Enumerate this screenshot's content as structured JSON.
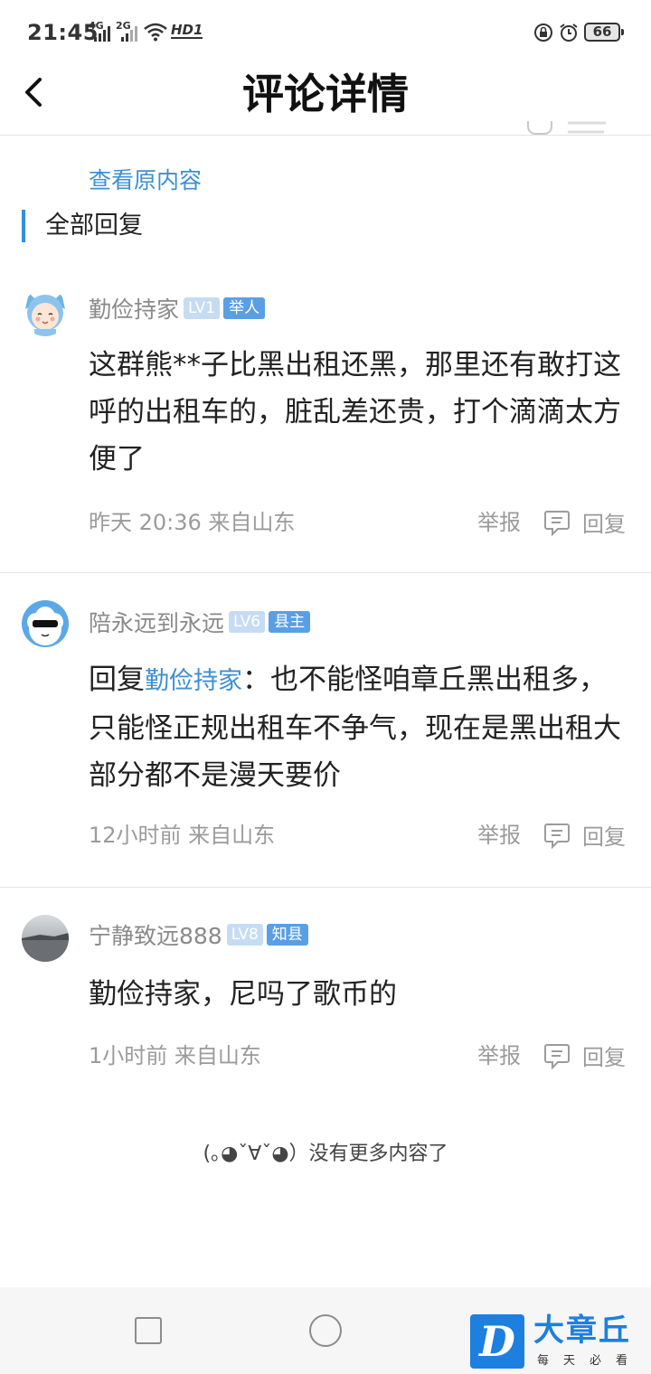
{
  "status_bar": {
    "time": "21:45",
    "signal1_label": "4G",
    "signal2_label": "2G",
    "hd_label": "HD1",
    "battery": "66"
  },
  "header": {
    "title": "评论详情"
  },
  "view_original": "查看原内容",
  "section_title": "全部回复",
  "comments": [
    {
      "username": "勤俭持家",
      "level": "LV1",
      "title_badge": "举人",
      "text": "这群熊**子比黑出租还黑，那里还有敢打这呼的出租车的，脏乱差还贵，打个滴滴太方便了",
      "time_location": "昨天 20:36 来自山东",
      "report": "举报",
      "reply": "回复"
    },
    {
      "username": "陪永远到永远",
      "level": "LV6",
      "title_badge": "县主",
      "reply_prefix": "回复",
      "mention": "勤俭持家",
      "text": "：也不能怪咱章丘黑出租多，只能怪正规出租车不争气，现在是黑出租大部分都不是漫天要价",
      "time_location": "12小时前 来自山东",
      "report": "举报",
      "reply": "回复"
    },
    {
      "username": "宁静致远888",
      "level": "LV8",
      "title_badge": "知县",
      "text": "勤俭持家，尼吗了歌币的",
      "time_location": "1小时前 来自山东",
      "report": "举报",
      "reply": "回复"
    }
  ],
  "footer_text": "(｡◕ˇ∀ˇ◕）没有更多内容了",
  "watermark": {
    "logo_letter": "D",
    "name": "大章丘",
    "slogan": "每天必看"
  }
}
